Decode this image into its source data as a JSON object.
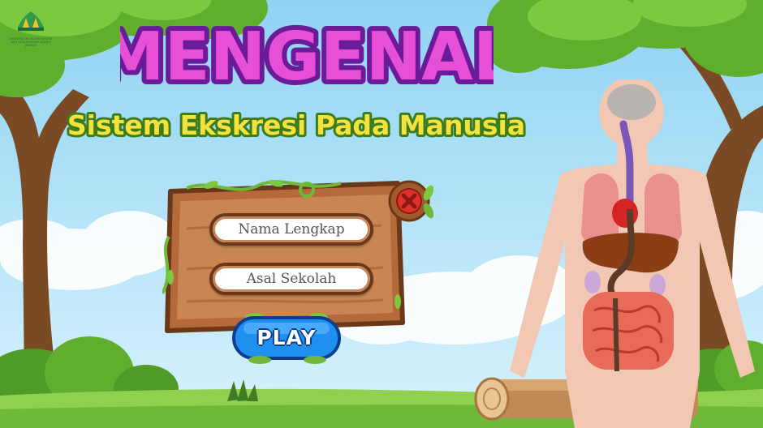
{
  "title": {
    "main": "MENGENAL",
    "sub": "Sistem Ekskresi Pada Manusia"
  },
  "logo": {
    "caption_line1": "UNIVERSITAS ISLAM NEGERI",
    "caption_line2": "KIAI HAJI ACHMAD SIDDIQ",
    "caption_line3": "JEMBER"
  },
  "form": {
    "name_placeholder": "Nama Lengkap",
    "school_placeholder": "Asal Sekolah",
    "name_value": "",
    "school_value": ""
  },
  "buttons": {
    "play_label": "PLAY",
    "close_icon": "close-x-icon"
  },
  "colors": {
    "sky": "#8fd3f2",
    "title_pink": "#e64fd6",
    "title_purple": "#6a1b9a",
    "subtitle_yellow": "#f6e23c",
    "subtitle_green": "#3b7d1e",
    "wood": "#b46a3a",
    "play_blue": "#1f8ff0",
    "close_red": "#e0312b"
  }
}
